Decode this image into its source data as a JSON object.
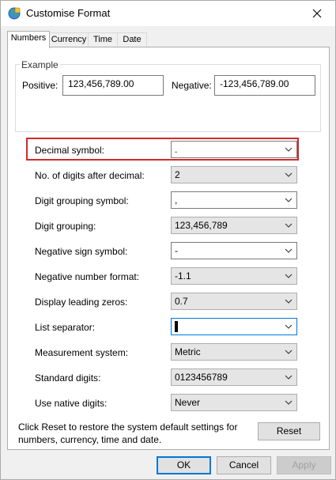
{
  "window": {
    "title": "Customise Format"
  },
  "tabs": [
    {
      "label": "Numbers"
    },
    {
      "label": "Currency"
    },
    {
      "label": "Time"
    },
    {
      "label": "Date"
    }
  ],
  "example": {
    "legend": "Example",
    "positive_label": "Positive:",
    "positive_value": "123,456,789.00",
    "negative_label": "Negative:",
    "negative_value": "-123,456,789.00"
  },
  "settings": [
    {
      "label": "Decimal symbol:",
      "value": "."
    },
    {
      "label": "No. of digits after decimal:",
      "value": "2"
    },
    {
      "label": "Digit grouping symbol:",
      "value": ","
    },
    {
      "label": "Digit grouping:",
      "value": "123,456,789"
    },
    {
      "label": "Negative sign symbol:",
      "value": "-"
    },
    {
      "label": "Negative number format:",
      "value": "-1.1"
    },
    {
      "label": "Display leading zeros:",
      "value": "0.7"
    },
    {
      "label": "List separator:",
      "value": ""
    },
    {
      "label": "Measurement system:",
      "value": "Metric"
    },
    {
      "label": "Standard digits:",
      "value": "0123456789"
    },
    {
      "label": "Use native digits:",
      "value": "Never"
    }
  ],
  "reset_note": "Click Reset to restore the system default settings for numbers, currency, time and date.",
  "buttons": {
    "reset": "Reset",
    "ok": "OK",
    "cancel": "Cancel",
    "apply": "Apply"
  },
  "colors": {
    "highlight": "#d12a2a",
    "focus": "#0078d7"
  }
}
